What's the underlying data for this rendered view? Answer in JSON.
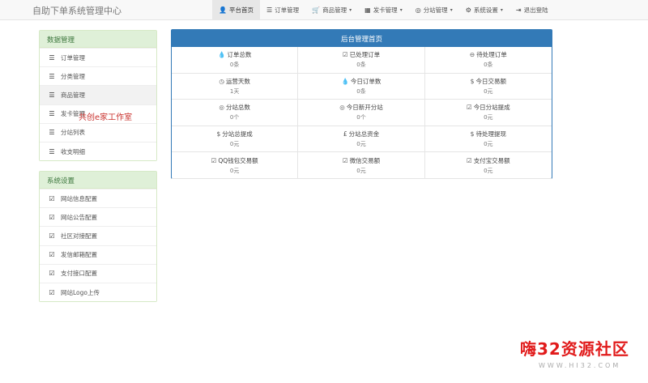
{
  "app": {
    "brand": "自助下单系统管理中心"
  },
  "navbar": {
    "items": [
      {
        "icon": "👤",
        "label": "平台首页",
        "caret": ""
      },
      {
        "icon": "☰",
        "label": "订单管理",
        "caret": ""
      },
      {
        "icon": "🛒",
        "label": "商品管理",
        "caret": "▾"
      },
      {
        "icon": "▦",
        "label": "发卡管理",
        "caret": "▾"
      },
      {
        "icon": "◎",
        "label": "分站管理",
        "caret": "▾"
      },
      {
        "icon": "⚙",
        "label": "系统设置",
        "caret": "▾"
      },
      {
        "icon": "⇥",
        "label": "退出登陆",
        "caret": ""
      }
    ]
  },
  "sidebar": {
    "data_panel": {
      "title": "数据管理",
      "items": [
        {
          "icon": "☰",
          "label": "订单管理"
        },
        {
          "icon": "☰",
          "label": "分类管理"
        },
        {
          "icon": "☰",
          "label": "商品管理"
        },
        {
          "icon": "☰",
          "label": "发卡管理"
        },
        {
          "icon": "☰",
          "label": "分站列表"
        },
        {
          "icon": "☰",
          "label": "收支明细"
        }
      ]
    },
    "settings_panel": {
      "title": "系统设置",
      "items": [
        {
          "icon": "☑",
          "label": "网站信息配置"
        },
        {
          "icon": "☑",
          "label": "网站公告配置"
        },
        {
          "icon": "☑",
          "label": "社区对接配置"
        },
        {
          "icon": "☑",
          "label": "发信邮箱配置"
        },
        {
          "icon": "☑",
          "label": "支付接口配置"
        },
        {
          "icon": "☑",
          "label": "网站Logo上传"
        }
      ]
    }
  },
  "main": {
    "title": "后台管理首页",
    "stats": [
      {
        "icon": "💧",
        "label": "订单总数",
        "value": "0条"
      },
      {
        "icon": "☑",
        "label": "已处理订单",
        "value": "0条"
      },
      {
        "icon": "⊖",
        "label": "待处理订单",
        "value": "0条"
      },
      {
        "icon": "◷",
        "label": "运营天数",
        "value": "1天"
      },
      {
        "icon": "💧",
        "label": "今日订单数",
        "value": "0条"
      },
      {
        "icon": "$",
        "label": "今日交易额",
        "value": "0元"
      },
      {
        "icon": "◎",
        "label": "分站总数",
        "value": "0个"
      },
      {
        "icon": "◎",
        "label": "今日新开分站",
        "value": "0个"
      },
      {
        "icon": "☑",
        "label": "今日分站提成",
        "value": "0元"
      },
      {
        "icon": "$",
        "label": "分站总提成",
        "value": "0元"
      },
      {
        "icon": "£",
        "label": "分站总资金",
        "value": "0元"
      },
      {
        "icon": "$",
        "label": "待处理提现",
        "value": "0元"
      },
      {
        "icon": "☑",
        "label": "QQ钱包交易额",
        "value": "0元"
      },
      {
        "icon": "☑",
        "label": "微信交易额",
        "value": "0元"
      },
      {
        "icon": "☑",
        "label": "支付宝交易额",
        "value": "0元"
      }
    ]
  },
  "overlay": {
    "text": "共创e家工作室"
  },
  "watermark": {
    "logo": "嗨32资源社区",
    "url": "WWW.HI32.COM"
  }
}
